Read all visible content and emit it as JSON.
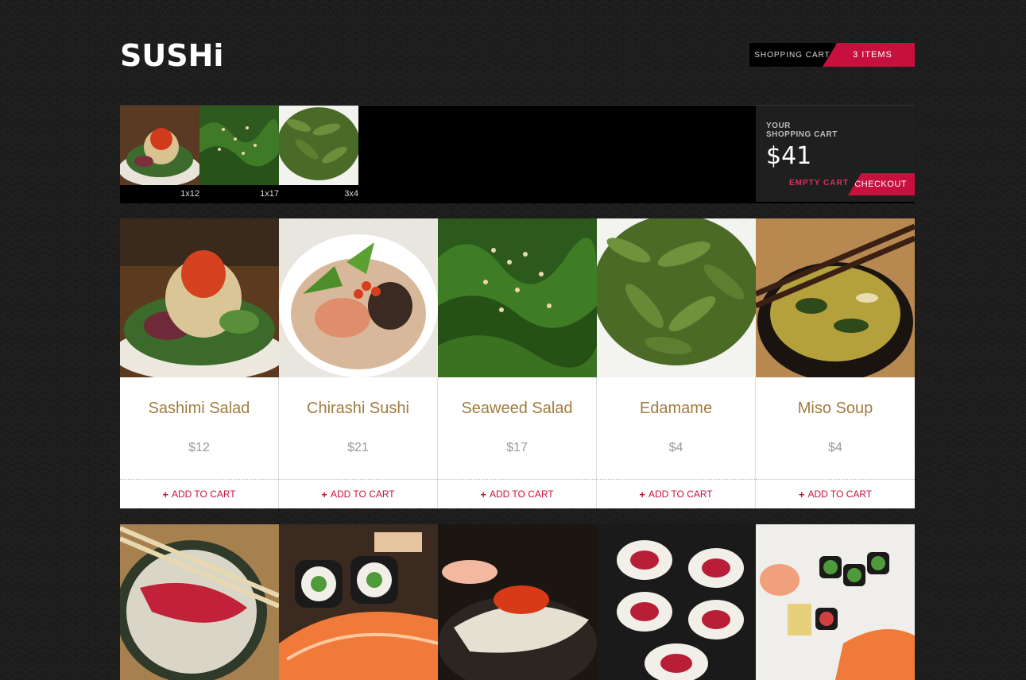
{
  "header": {
    "logo": "SUSHi",
    "cart_tab_label": "SHOPPING CART",
    "cart_tab_count": "3 ITEMS"
  },
  "cart": {
    "items": [
      {
        "qty": "1x12",
        "image": "sashimi-salad"
      },
      {
        "qty": "1x17",
        "image": "seaweed-salad"
      },
      {
        "qty": "3x4",
        "image": "edamame"
      }
    ],
    "title_line1": "YOUR",
    "title_line2": "SHOPPING CART",
    "total": "$41",
    "empty_label": "EMPTY CART",
    "checkout_label": "CHECKOUT"
  },
  "products": [
    {
      "name": "Sashimi Salad",
      "price": "$12",
      "add_label": "ADD TO CART",
      "image": "sashimi-salad"
    },
    {
      "name": "Chirashi Sushi",
      "price": "$21",
      "add_label": "ADD TO CART",
      "image": "chirashi-sushi"
    },
    {
      "name": "Seaweed Salad",
      "price": "$17",
      "add_label": "ADD TO CART",
      "image": "seaweed-salad"
    },
    {
      "name": "Edamame",
      "price": "$4",
      "add_label": "ADD TO CART",
      "image": "edamame"
    },
    {
      "name": "Miso Soup",
      "price": "$4",
      "add_label": "ADD TO CART",
      "image": "miso-soup"
    }
  ],
  "products_row2": [
    {
      "image": "tuna-nigiri"
    },
    {
      "image": "salmon-maki"
    },
    {
      "image": "roe-nigiri"
    },
    {
      "image": "tuna-maki"
    },
    {
      "image": "sushi-platter"
    }
  ],
  "colors": {
    "accent": "#c8103f",
    "product_name": "#a27c3e",
    "price": "#999999",
    "background": "#1b1b1b"
  }
}
